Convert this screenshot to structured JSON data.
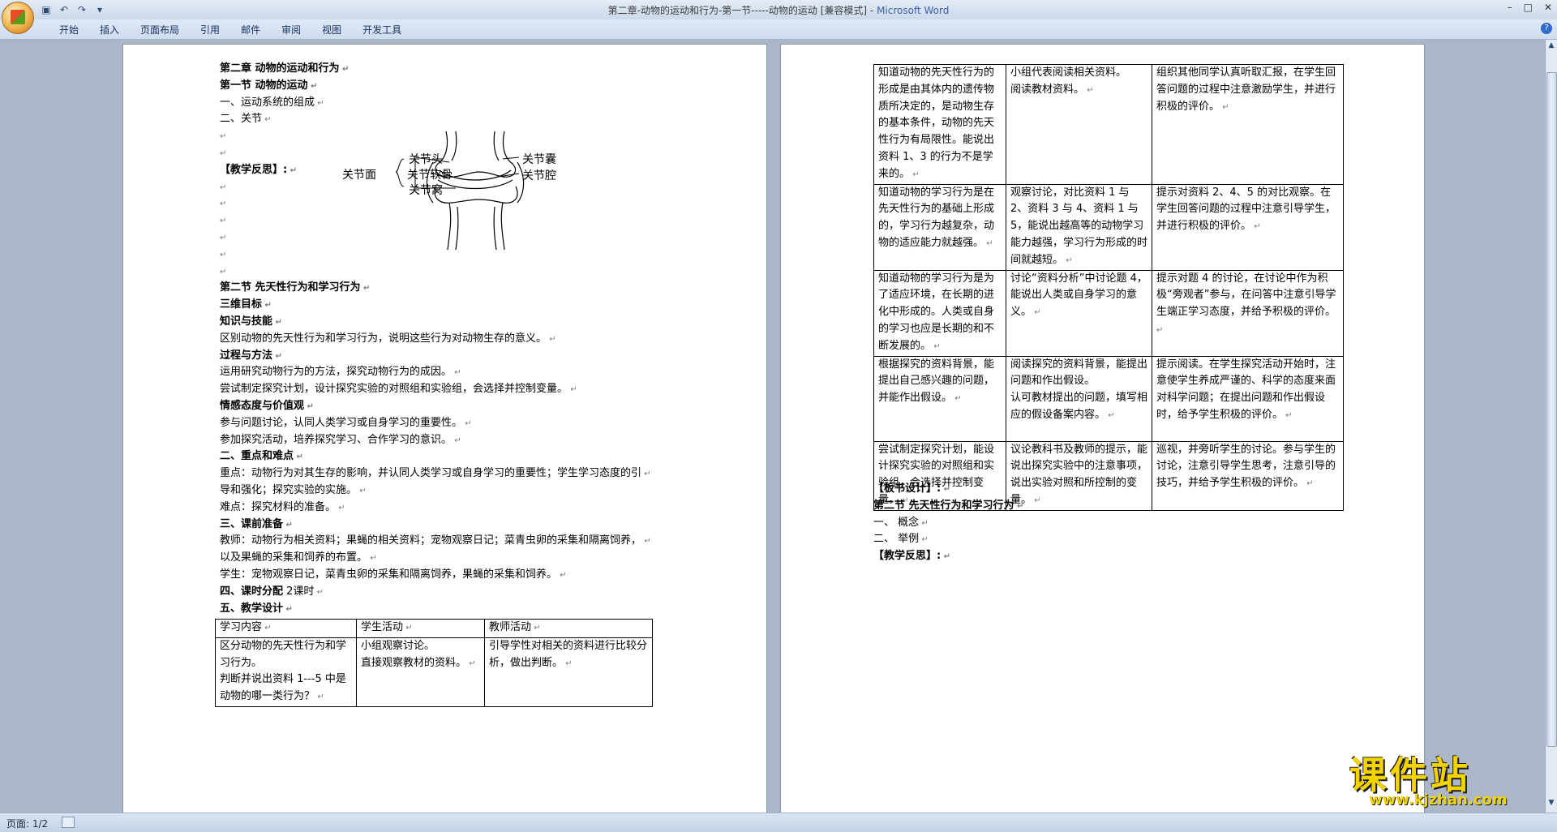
{
  "window": {
    "title_doc": "第二章-动物的运动和行为-第一节-----动物的运动 [兼容模式] - ",
    "title_app": "Microsoft Word"
  },
  "ribbon": {
    "tabs": [
      "开始",
      "插入",
      "页面布局",
      "引用",
      "邮件",
      "审阅",
      "视图",
      "开发工具"
    ]
  },
  "page1": {
    "lines": [
      {
        "text": "第二章 动物的运动和行为",
        "bold": true
      },
      {
        "text": "第一节            动物的运动",
        "bold": true
      },
      {
        "text": "一、运动系统的组成",
        "bold": false
      },
      {
        "text": "二、关节",
        "bold": false
      },
      {
        "text": "",
        "bold": false
      },
      {
        "text": "",
        "bold": false
      },
      {
        "text": "【教学反思】:",
        "bold": true
      },
      {
        "text": "",
        "bold": false
      },
      {
        "text": "",
        "bold": false
      },
      {
        "text": "",
        "bold": false
      },
      {
        "text": "",
        "bold": false
      },
      {
        "text": "",
        "bold": false
      },
      {
        "text": "",
        "bold": false
      },
      {
        "text": "第二节   先天性行为和学习行为",
        "bold": true
      },
      {
        "text": "三维目标",
        "bold": true
      },
      {
        "text": "知识与技能",
        "bold": true
      },
      {
        "text": "区别动物的先天性行为和学习行为，说明这些行为对动物生存的意义。",
        "bold": false
      },
      {
        "text": "过程与方法",
        "bold": true
      },
      {
        "text": "  运用研究动物行为的方法，探究动物行为的成因。",
        "bold": false
      },
      {
        "text": "尝试制定探究计划，设计探究实验的对照组和实验组，会选择并控制变量。",
        "bold": false
      },
      {
        "text": "情感态度与价值观",
        "bold": true
      },
      {
        "text": "参与问题讨论，认同人类学习或自身学习的重要性。",
        "bold": false
      },
      {
        "text": "参加探究活动，培养探究学习、合作学习的意识。",
        "bold": false
      },
      {
        "text": "二、重点和难点",
        "bold": true
      },
      {
        "text": "重点：动物行为对其生存的影响，并认同人类学习或自身学习的重要性；学生学习态度的引",
        "bold": false
      },
      {
        "text": "导和强化；探究实验的实施。",
        "bold": false
      },
      {
        "text": "难点：探究材料的准备。",
        "bold": false
      },
      {
        "text": "三、课前准备",
        "bold": true
      },
      {
        "text": "教师：动物行为相关资料；果蝇的相关资料；宠物观察日记；菜青虫卵的采集和隔离饲养，",
        "bold": false
      },
      {
        "text": "以及果蝇的采集和饲养的布置。",
        "bold": false
      },
      {
        "text": "学生：宠物观察日记，菜青虫卵的采集和隔离饲养，果蝇的采集和饲养。",
        "bold": false
      },
      {
        "text": "四、课时分配 2课时",
        "bold": false,
        "boldPrefix": "四、课时分配"
      },
      {
        "text": "五、教学设计",
        "bold": true
      }
    ],
    "diagram": {
      "surface": "关节面",
      "head": "关节头",
      "cartilage": "关节软骨",
      "socket": "关节窝",
      "capsule": "关节囊",
      "cavity": "关节腔"
    },
    "table": {
      "headers": [
        "学习内容",
        "学生活动",
        "教师活动"
      ],
      "rows": [
        [
          "区分动物的先天性行为和学习行为。\n判断并说出资料 1---5 中是动物的哪一类行为？",
          "小组观察讨论。\n直接观察教材的资料。",
          "引导学性对相关的资料进行比较分析，做出判断。"
        ]
      ]
    }
  },
  "page2": {
    "table": {
      "rows": [
        [
          "知道动物的先天性行为的形成是由其体内的遗传物质所决定的，是动物生存的基本条件，动物的先天性行为有局限性。能说出资料 1、3 的行为不是学来的。",
          "小组代表阅读相关资料。\n阅读教材资料。",
          "组织其他同学认真听取汇报，在学生回答问题的过程中注意激励学生，并进行积极的评价。"
        ],
        [
          "知道动物的学习行为是在先天性行为的基础上形成的，学习行为越复杂，动物的适应能力就越强。",
          "观察讨论，对比资料 1 与 2、资料 3 与 4、资料 1 与 5，能说出越高等的动物学习能力越强，学习行为形成的时间就越短。",
          "提示对资料 2、4、5 的对比观察。在学生回答问题的过程中注意引导学生，并进行积极的评价。"
        ],
        [
          "知道动物的学习行为是为了适应环境，在长期的进化中形成的。人类或自身的学习也应是长期的和不断发展的。",
          "  讨论“资料分析”中讨论题 4，能说出人类或自身学习的意义。",
          "  提示对题 4 的讨论，在讨论中作为积极“旁观者”参与，在问答中注意引导学生端正学习态度，并给予积极的评价。"
        ],
        [
          "根据探究的资料背景，能提出自己感兴趣的问题，并能作出假设。",
          "阅读探究的资料背景，能提出问题和作出假设。\n认可教材提出的问题，填写相应的假设备案内容。",
          "提示阅读。在学生探究活动开始时，注意使学生养成严谨的、科学的态度来面对科学问题；在提出问题和作出假设时，给予学生积极的评价。"
        ],
        [
          "尝试制定探究计划，能设计探究实验的对照组和实验组，会选择并控制变量。",
          "议论教科书及教师的提示，能说出探究实验中的注意事项，说出实验对照和所控制的变量。",
          "巡视，并旁听学生的讨论。参与学生的讨论，注意引导学生思考，注意引导的技巧，并给予学生积极的评价。"
        ]
      ]
    },
    "lines": [
      {
        "text": "【板书设计】:",
        "bold": true
      },
      {
        "text": "第二节   先天性行为和学习行为",
        "bold": true
      },
      {
        "text": "一、  概念",
        "bold": false
      },
      {
        "text": "二、  举例",
        "bold": false
      },
      {
        "text": "【教学反思】:",
        "bold": true
      }
    ]
  },
  "status": {
    "page": "页面: 1/2"
  },
  "watermark": {
    "title": "课件站",
    "url": "www.kjzhan.com"
  }
}
